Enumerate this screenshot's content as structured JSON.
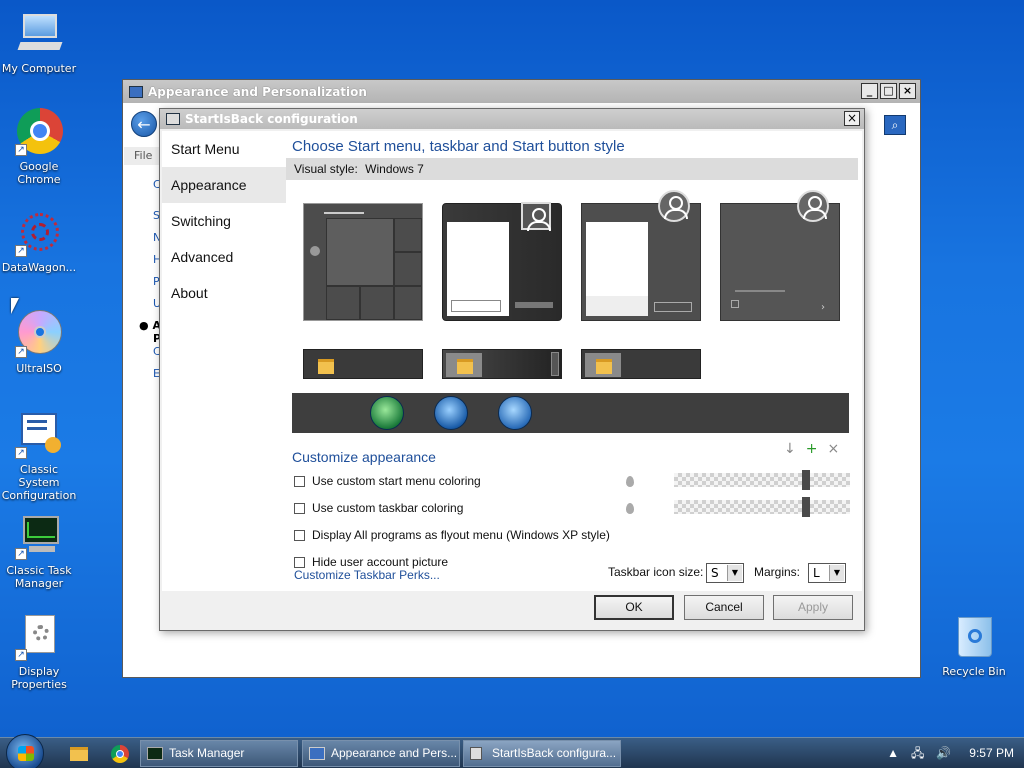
{
  "desktop": {
    "icons": [
      {
        "label": "My Computer",
        "icon": "computer-icon"
      },
      {
        "label": "Google Chrome",
        "icon": "chrome-icon"
      },
      {
        "label": "DataWagon...",
        "icon": "datawagon-icon"
      },
      {
        "label": "UltraISO",
        "icon": "disc-icon"
      },
      {
        "label": "Classic System Configuration",
        "icon": "system-config-icon"
      },
      {
        "label": "Classic Task Manager",
        "icon": "task-manager-icon"
      },
      {
        "label": "Display Properties",
        "icon": "display-properties-icon"
      },
      {
        "label": "Recycle Bin",
        "icon": "recycle-bin-icon"
      }
    ]
  },
  "outer_window": {
    "title": "Appearance and Personalization",
    "menu": "File",
    "side_letters": [
      "C",
      "S",
      "N",
      "H",
      "P",
      "U",
      "A",
      "P",
      "C",
      "E"
    ]
  },
  "dialog": {
    "title": "StartIsBack configuration",
    "nav": [
      "Start Menu",
      "Appearance",
      "Switching",
      "Advanced",
      "About"
    ],
    "active_nav": "Appearance",
    "heading": "Choose Start menu, taskbar and Start button style",
    "visual_style_label": "Visual style:",
    "visual_style_value": "Windows 7",
    "customize_heading": "Customize appearance",
    "options": [
      {
        "label": "Use custom start menu coloring",
        "checked": false
      },
      {
        "label": "Use custom taskbar coloring",
        "checked": false
      },
      {
        "label": "Display All programs as flyout menu (Windows XP style)",
        "checked": false
      },
      {
        "label": "Hide user account picture",
        "checked": false
      }
    ],
    "slider_levels": [
      0.76,
      0.76
    ],
    "link": "Customize Taskbar Perks...",
    "icon_size_label": "Taskbar icon size:",
    "icon_size_value": "S",
    "margins_label": "Margins:",
    "margins_value": "L",
    "buttons": {
      "ok": "OK",
      "cancel": "Cancel",
      "apply": "Apply"
    }
  },
  "taskbar": {
    "tasks": [
      "Task Manager",
      "Appearance and Pers...",
      "StartIsBack configura..."
    ],
    "time": "9:57 PM"
  },
  "colors": {
    "accent": "#1f4f9a",
    "desktop": "#1874e0"
  }
}
